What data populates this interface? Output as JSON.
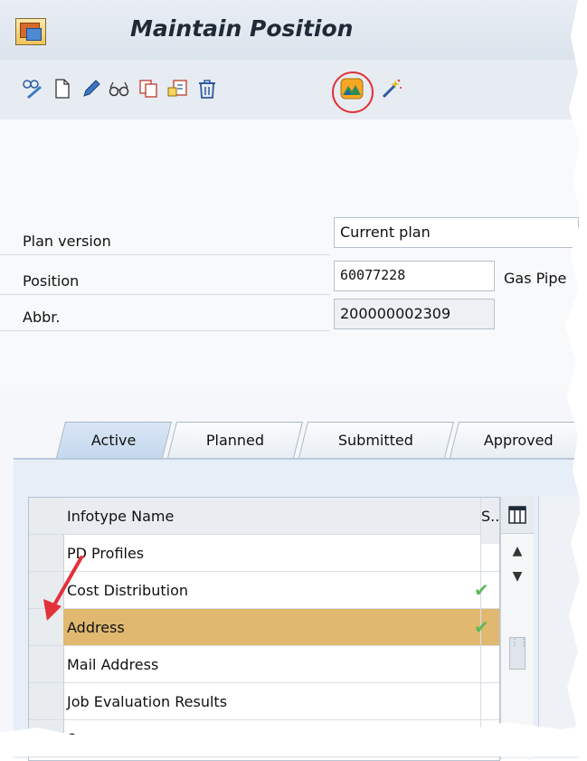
{
  "window": {
    "title": "Maintain Position"
  },
  "toolbar": {
    "icons": [
      "edit-glasses-icon",
      "create-icon",
      "change-icon",
      "display-icon",
      "copy-icon",
      "delimit-icon",
      "delete-icon",
      "overview-icon",
      "wizard-icon"
    ]
  },
  "form": {
    "plan_version_label": "Plan version",
    "plan_version_value": "Current plan",
    "position_label": "Position",
    "position_value": "60077228",
    "position_text": "Gas Pipe",
    "abbr_label": "Abbr.",
    "abbr_value": "200000002309"
  },
  "tabs": [
    "Active",
    "Planned",
    "Submitted",
    "Approved"
  ],
  "table": {
    "headers": {
      "name": "Infotype Name",
      "status": "S.."
    },
    "rows": [
      {
        "name": "PD Profiles",
        "checked": false
      },
      {
        "name": "Cost Distribution",
        "checked": true
      },
      {
        "name": "Address",
        "checked": true,
        "selected": true
      },
      {
        "name": "Mail Address",
        "checked": false
      },
      {
        "name": "Job Evaluation Results",
        "checked": false
      },
      {
        "name": "S...",
        "checked": false
      }
    ]
  },
  "colors": {
    "selected_row": "#e0b86f",
    "annotation": "#e2323a"
  }
}
